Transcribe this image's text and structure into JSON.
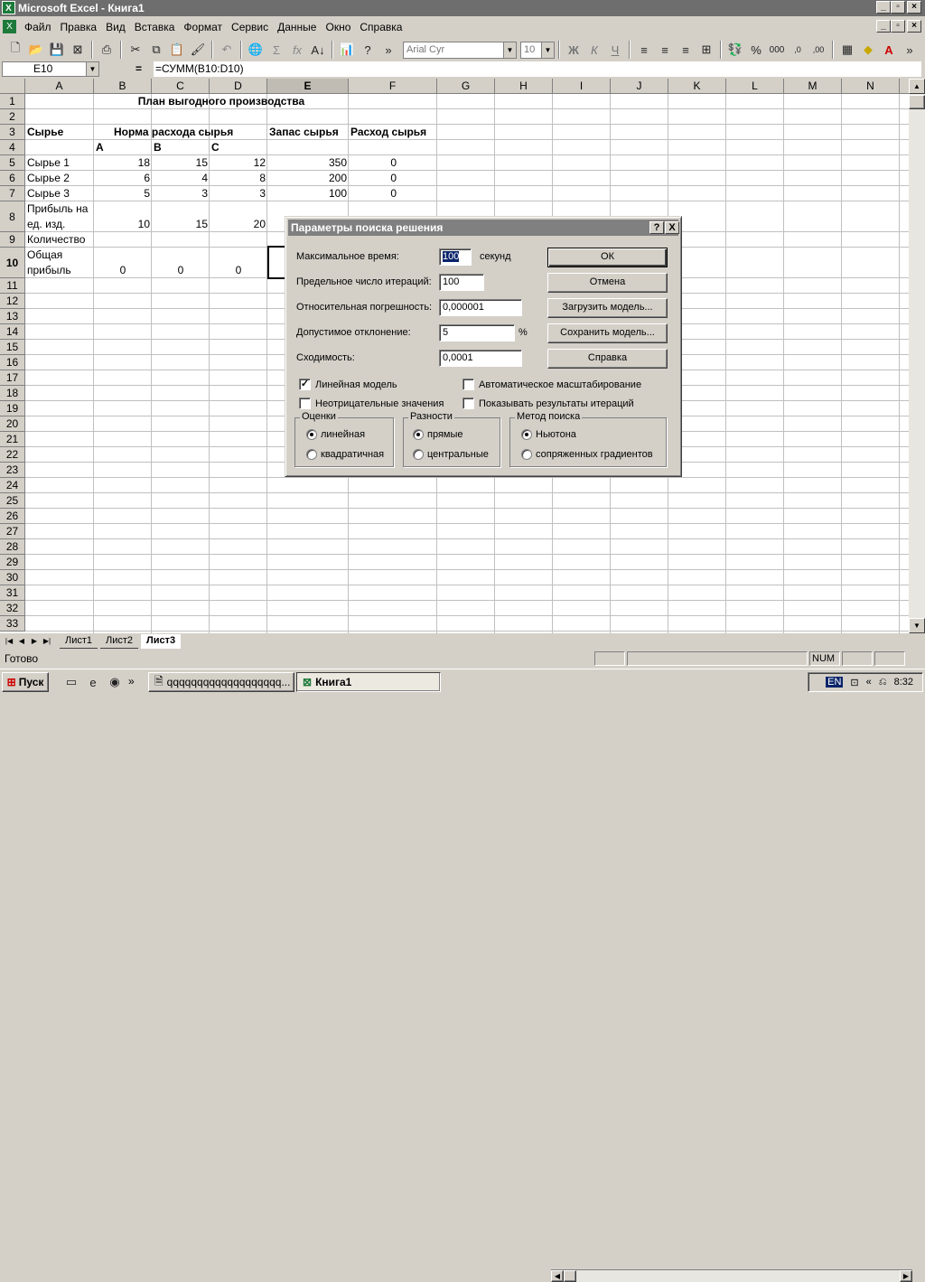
{
  "window": {
    "title": "Microsoft Excel - Книга1",
    "app_icon": "excel-icon"
  },
  "menu": [
    "Файл",
    "Правка",
    "Вид",
    "Вставка",
    "Формат",
    "Сервис",
    "Данные",
    "Окно",
    "Справка"
  ],
  "toolbar": {
    "font_name": "Arial Cyr",
    "font_size": "10",
    "bold_label": "Ж",
    "italic_label": "К",
    "underline_label": "Ч"
  },
  "formula_bar": {
    "name_box": "E10",
    "equals": "=",
    "formula": "=СУММ(B10:D10)"
  },
  "columns": [
    "A",
    "B",
    "C",
    "D",
    "E",
    "F",
    "G",
    "H",
    "I",
    "J",
    "K",
    "L",
    "M",
    "N"
  ],
  "rows": [
    "1",
    "2",
    "3",
    "4",
    "5",
    "6",
    "7",
    "8",
    "9",
    "10",
    "11",
    "12",
    "13",
    "14",
    "15",
    "16",
    "17",
    "18",
    "19",
    "20",
    "21",
    "22",
    "23",
    "24",
    "25",
    "26",
    "27",
    "28",
    "29",
    "30",
    "31",
    "32",
    "33"
  ],
  "cells": {
    "B1": "План выгодного производства",
    "A3": "Сырье",
    "B3": "Норма расхода сырья",
    "E3": "Запас сырья",
    "F3": "Расход сырья",
    "B4": "A",
    "C4": "B",
    "D4": "C",
    "A5": "Сырье 1",
    "B5": "18",
    "C5": "15",
    "D5": "12",
    "E5": "350",
    "F5": "0",
    "A6": "Сырье 2",
    "B6": "6",
    "C6": "4",
    "D6": "8",
    "E6": "200",
    "F6": "0",
    "A7": "Сырье 3",
    "B7": "5",
    "C7": "3",
    "D7": "3",
    "E7": "100",
    "F7": "0",
    "A8a": "Прибыль на",
    "A8b": "ед. изд.",
    "B8": "10",
    "C8": "15",
    "D8": "20",
    "A9": "Количество",
    "A10a": "Общая",
    "A10b": "прибыль",
    "B10": "0",
    "C10": "0",
    "D10": "0"
  },
  "sheet_tabs": [
    "Лист1",
    "Лист2",
    "Лист3"
  ],
  "active_sheet": "Лист3",
  "status": {
    "ready": "Готово",
    "num": "NUM"
  },
  "taskbar": {
    "start": "Пуск",
    "tasks": [
      "qqqqqqqqqqqqqqqqqqq...",
      "Книга1"
    ],
    "lang": "EN",
    "time": "8:32"
  },
  "dialog": {
    "title": "Параметры поиска решения",
    "help_glyph": "?",
    "close_glyph": "X",
    "max_time_label": "Максимальное время:",
    "max_time_value": "100",
    "max_time_unit": "секунд",
    "iterations_label": "Предельное число итераций:",
    "iterations_value": "100",
    "precision_label": "Относительная погрешность:",
    "precision_value": "0,000001",
    "tolerance_label": "Допустимое отклонение:",
    "tolerance_value": "5",
    "tolerance_unit": "%",
    "convergence_label": "Сходимость:",
    "convergence_value": "0,0001",
    "buttons": {
      "ok": "ОК",
      "cancel": "Отмена",
      "load": "Загрузить модель...",
      "save": "Сохранить модель...",
      "help": "Справка"
    },
    "checkboxes": {
      "linear": "Линейная модель",
      "linear_checked": true,
      "auto_scale": "Автоматическое масштабирование",
      "auto_scale_checked": false,
      "nonneg": "Неотрицательные значения",
      "nonneg_checked": false,
      "show_iter": "Показывать результаты итераций",
      "show_iter_checked": false
    },
    "estimates": {
      "title": "Оценки",
      "opt1": "линейная",
      "opt2": "квадратичная",
      "selected": "линейная"
    },
    "derivatives": {
      "title": "Разности",
      "opt1": "прямые",
      "opt2": "центральные",
      "selected": "прямые"
    },
    "search": {
      "title": "Метод поиска",
      "opt1": "Ньютона",
      "opt2": "сопряженных градиентов",
      "selected": "Ньютона"
    }
  }
}
